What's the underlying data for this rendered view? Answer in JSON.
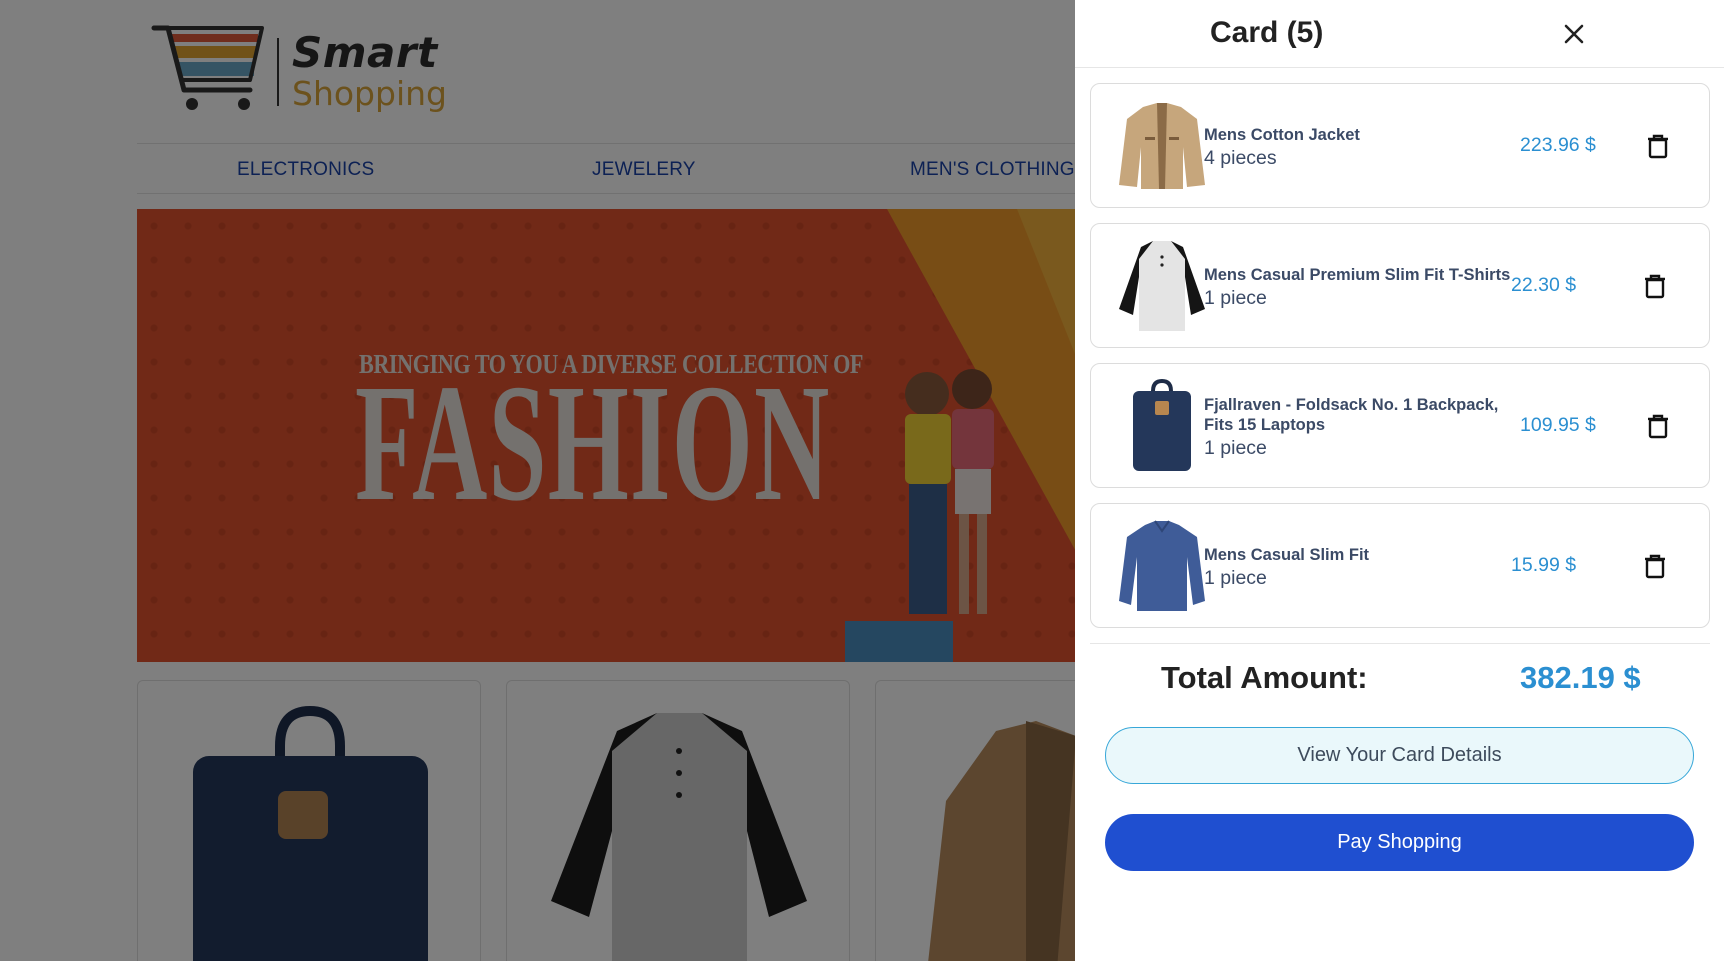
{
  "logo": {
    "line1": "Smart",
    "line2": "Shopping"
  },
  "nav": {
    "items": [
      "ELECTRONICS",
      "JEWELERY",
      "MEN'S CLOTHING"
    ]
  },
  "banner": {
    "subtitle": "BRINGING TO YOU A DIVERSE COLLECTION OF",
    "title": "FASHION"
  },
  "cart": {
    "title": "Card (5)",
    "items": [
      {
        "name": "Mens Cotton Jacket",
        "qty": "4 pieces",
        "price": "223.96 $",
        "icon": "jacket"
      },
      {
        "name": "Mens Casual Premium Slim Fit T-Shirts",
        "qty": "1 piece",
        "price": "22.30 $",
        "icon": "raglan-shirt"
      },
      {
        "name": "Fjallraven - Foldsack No. 1 Backpack, Fits 15 Laptops",
        "qty": "1 piece",
        "price": "109.95 $",
        "icon": "backpack"
      },
      {
        "name": "Mens Casual Slim Fit",
        "qty": "1 piece",
        "price": "15.99 $",
        "icon": "long-sleeve-shirt"
      }
    ],
    "total_label": "Total Amount:",
    "total_value": "382.19 $",
    "view_details_label": "View Your Card Details",
    "pay_label": "Pay Shopping"
  },
  "colors": {
    "accent_blue": "#1f4fd0",
    "price_blue": "#2b8fd1",
    "banner_orange": "#e2532e"
  }
}
